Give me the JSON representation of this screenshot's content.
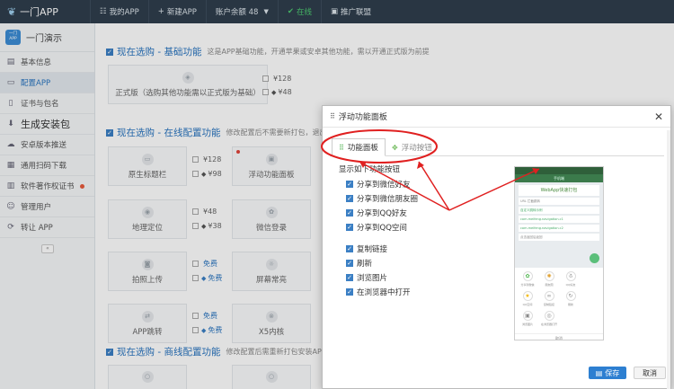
{
  "app": {
    "logo": "一门APP"
  },
  "topnav": {
    "my_app": "我的APP",
    "new_app": "新建APP",
    "balance": "账户余额 48",
    "status": "在线",
    "affiliate": "推广联盟"
  },
  "sidebar": {
    "app_icon_text": "一门 APP",
    "app_name": "一门演示",
    "items": [
      {
        "label": "基本信息"
      },
      {
        "label": "配置APP"
      },
      {
        "label": "证书与包名"
      },
      {
        "label": "生成安装包"
      },
      {
        "label": "安卓版本推送"
      },
      {
        "label": "通用扫码下载"
      },
      {
        "label": "软件著作权证书"
      },
      {
        "label": "管理用户"
      },
      {
        "label": "转让 APP"
      }
    ]
  },
  "main": {
    "sec1": {
      "title": "现在选购 - 基础功能",
      "desc": "这是APP基础功能，开通苹果或安卓其他功能，需以开通正式版为前提"
    },
    "sec1_card": "正式版（选购其他功能需以正式版为基础）",
    "sec1_prices": [
      "¥128",
      "¥48"
    ],
    "sec2": {
      "title": "现在选购 - 在线配置功能",
      "desc": "修改配置后不需要新打包，退出APP"
    },
    "cards": [
      {
        "label": "原生标题栏",
        "p1": "¥128",
        "p2": "¥98"
      },
      {
        "label": "浮动功能面板"
      },
      {
        "label": "地理定位",
        "p1": "¥48",
        "p2": "¥38"
      },
      {
        "label": "微信登录"
      },
      {
        "label": "拍照上传",
        "p1": "免费",
        "p2": "免费"
      },
      {
        "label": "屏幕常亮"
      },
      {
        "label": "APP跳转",
        "p1": "免费",
        "p2": "免费"
      },
      {
        "label": "X5内核"
      }
    ],
    "sec3": {
      "title": "现在选购 - 商线配置功能",
      "desc": "修改配置后需重新打包安装APP"
    }
  },
  "modal": {
    "title": "浮动功能面板",
    "tabs": [
      "功能面板",
      "浮动按钮"
    ],
    "heading": "显示如下功能按钮",
    "options": [
      "分享到微信好友",
      "分享到微信朋友圈",
      "分享到QQ好友",
      "分享到QQ空间",
      "复制链接",
      "刷新",
      "浏览图片",
      "在浏览器中打开"
    ],
    "save": "保存",
    "cancel": "取消"
  },
  "phone": {
    "header": "手机端",
    "title": "WebApp快速打包",
    "rows": [
      "URL 拦截跳转",
      "自定义跳转示例",
      "com.meifeng.navigation.c1",
      "com.meifeng.navigation.c2",
      "点击返回后返回"
    ],
    "share_labels": [
      "分享到微信",
      "朋友圈",
      "QQ好友",
      "QQ空间",
      "复制链接",
      "刷新",
      "浏览图片",
      "在浏览器打开"
    ],
    "cancel": "取消"
  }
}
